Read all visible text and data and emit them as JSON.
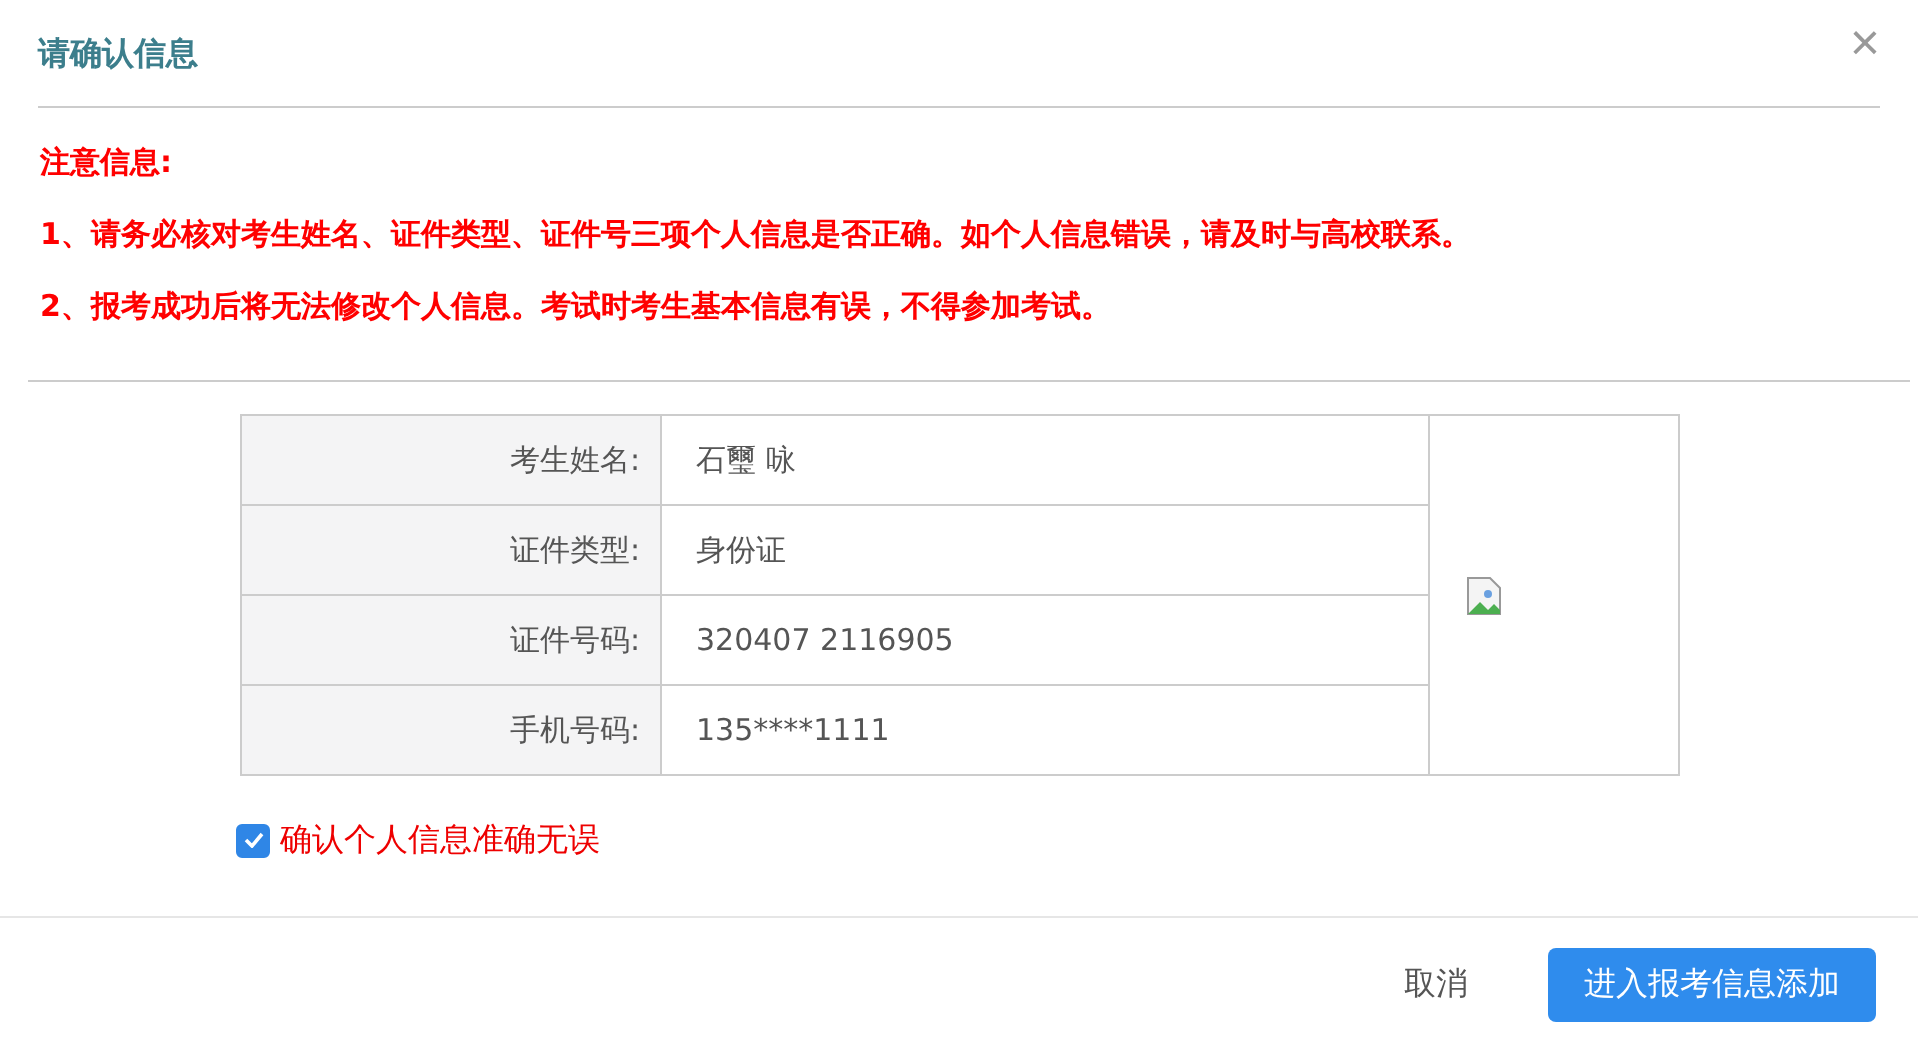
{
  "dialog": {
    "title": "请确认信息",
    "close": "×"
  },
  "notice": {
    "heading": "注意信息:",
    "items": [
      "1、请务必核对考生姓名、证件类型、证件号三项个人信息是否正确。如个人信息错误，请及时与高校联系。",
      "2、报考成功后将无法修改个人信息。考试时考生基本信息有误，不得参加考试。"
    ]
  },
  "info_table": {
    "rows": [
      {
        "label": "考生姓名:",
        "value": "石璽 咏"
      },
      {
        "label": "证件类型:",
        "value": "身份证"
      },
      {
        "label": "证件号码:",
        "value": "320407 2116905"
      },
      {
        "label": "手机号码:",
        "value": "135****1111"
      }
    ],
    "photo": {
      "kind": "broken-image"
    }
  },
  "confirm": {
    "label": "确认个人信息准确无误",
    "checked": true
  },
  "buttons": [
    {
      "label": "取消",
      "kind": "text"
    },
    {
      "label": "进入报考信息添加",
      "kind": "primary"
    }
  ]
}
